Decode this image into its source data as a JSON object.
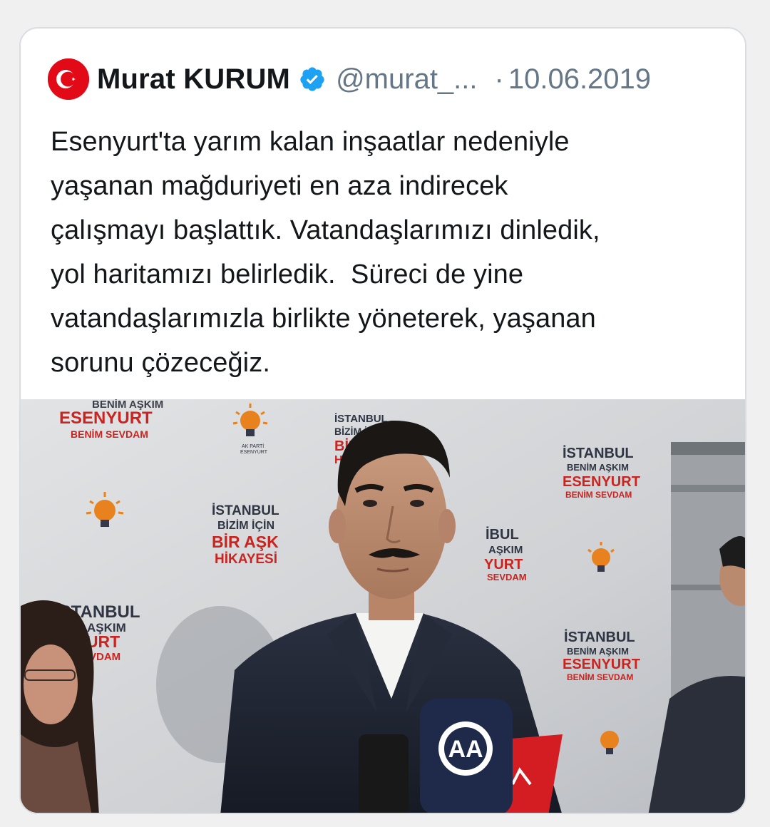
{
  "tweet": {
    "author_name": "Murat KURUM",
    "handle": "@murat_...",
    "separator": "·",
    "date": "10.06.2019",
    "text": "Esenyurt'ta yarım kalan inşaatlar nedeniyle\nyaşanan mağduriyeti en aza indirecek\nçalışmayı başlattık. Vatandaşlarımızı dinledik,\nyol haritamızı belirledik.  Süreci de yine\nvatandaşlarımızla birlikte yöneterek, yaşanan\nsorunu çözeceğiz.",
    "avatar_icon": "turkish-flag-icon",
    "verified_icon": "verified-badge-icon"
  },
  "media": {
    "backdrop_texts": [
      {
        "lines": [
          "BENİM AŞKIM",
          "ESENYURT",
          "BENİM SEVDAM"
        ]
      },
      {
        "lines": [
          "İSTANBUL",
          "BİZİM İÇİN",
          "BİR AŞK",
          "HİKAYESİ"
        ]
      },
      {
        "lines": [
          "İSTANBUL",
          "BİZİM İÇİN",
          "BİR",
          "Hİ"
        ]
      },
      {
        "lines": [
          "İSTANBUL",
          "BENİM AŞKIM",
          "ESENYURT",
          "BENİM SEVDAM"
        ]
      },
      {
        "lines": [
          "İBUL",
          "AŞKIM",
          "YURT",
          "SEVDAM"
        ]
      },
      {
        "lines": [
          "İSTANBUL",
          "BENİM AŞKIM",
          "ESENYURT",
          "BENİM SEVDAM"
        ]
      },
      {
        "lines": [
          "İSTANBUL",
          "İM AŞKIM",
          "NYURT",
          "SEVDAM"
        ]
      },
      {
        "lines": [
          "AK PARTİ",
          "ESENYURT"
        ]
      }
    ],
    "mic_logo": "AA",
    "colors": {
      "backdrop": "#d7d9dc",
      "orange": "#e8821e",
      "navy": "#1f2a4a",
      "red": "#d31d22"
    }
  },
  "colors": {
    "text": "#14171a",
    "muted": "#657786",
    "verified": "#1da1f2",
    "flag_red": "#e30a17"
  }
}
